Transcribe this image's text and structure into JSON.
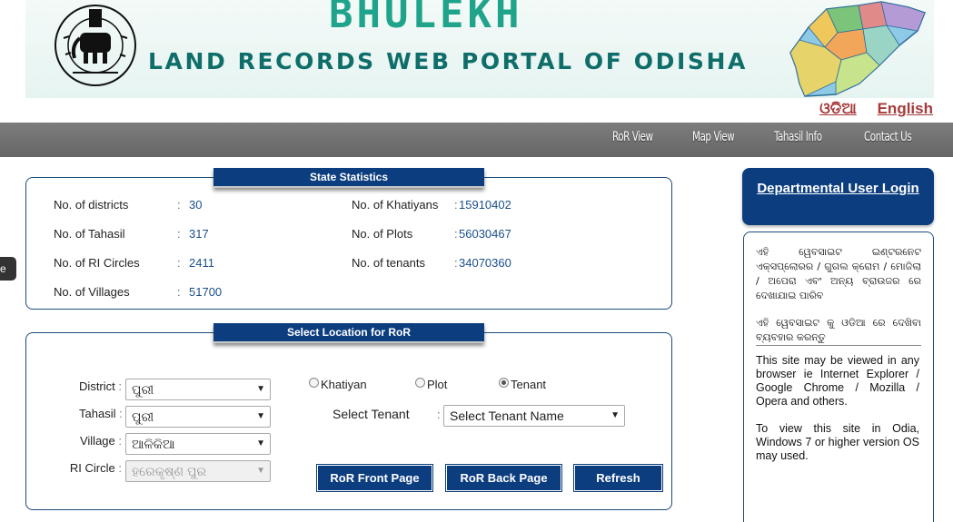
{
  "header": {
    "brand": "BHULEKH",
    "title": "LAND RECORDS WEB PORTAL OF ODISHA",
    "languages": [
      "ଓଡିଆ",
      "English"
    ]
  },
  "nav": {
    "items": [
      "RoR View",
      "Map View",
      "Tahasil Info",
      "Contact Us"
    ]
  },
  "side_tab": {
    "label": "e"
  },
  "state_statistics": {
    "heading": "State Statistics",
    "left": [
      {
        "label": "No. of districts",
        "value": "30"
      },
      {
        "label": "No. of Tahasil",
        "value": "317"
      },
      {
        "label": "No. of RI Circles",
        "value": "2411"
      },
      {
        "label": "No. of Villages",
        "value": "51700"
      }
    ],
    "right": [
      {
        "label": "No. of Khatiyans",
        "value": "15910402"
      },
      {
        "label": "No. of Plots",
        "value": "56030467"
      },
      {
        "label": "No. of tenants",
        "value": "34070360"
      }
    ],
    "separator": ":"
  },
  "ror": {
    "heading": "Select Location for RoR",
    "district": {
      "label": "District",
      "value": "ପୁରୀ"
    },
    "tahasil": {
      "label": "Tahasil",
      "value": "ପୁରୀ"
    },
    "village": {
      "label": "Village",
      "value": "ଆଳିକିଆ"
    },
    "ri_circle": {
      "label": "RI Circle",
      "value": "ହରେକୃଷ୍ଣ ପୁର"
    },
    "search_by": {
      "options": [
        "Khatiyan",
        "Plot",
        "Tenant"
      ],
      "selected": "Tenant"
    },
    "tenant": {
      "label": "Select Tenant",
      "value": "Select Tenant Name"
    },
    "buttons": {
      "front": "RoR Front Page",
      "back": "RoR Back Page",
      "refresh": "Refresh"
    }
  },
  "sidebar": {
    "login_label": "Departmental User Login",
    "odia_note_1": "ଏହି ୱେବସାଇଟ ଇଣ୍ଟରନେଟ ଏକ୍ସପ୍ଲୋରର / ଗୁଗଲ କ୍ରୋମ / ମୋଜିଲା / ଅପେରା ଏବଂ ଅନ୍ୟ ବ୍ରାଉଜର ରେ ଦେଖାଯାଇ ପାରିବ",
    "odia_note_2": "ଏହି ୱେବସାଇଟ କୁ ଓଡିଆ ରେ ଦେଖିବା ବ୍ୟବହାର କରନ୍ତୁ",
    "en_note_1": "This site may be viewed in any browser ie Internet Explorer / Google Chrome / Mozilla / Opera and others.",
    "en_note_2": "To view this site in Odia, Windows 7 or higher version OS may used."
  },
  "colors": {
    "primary": "#0b3d7f",
    "nav_gray": "#707070",
    "brand_teal": "#1fa38a",
    "lang_link": "#a63a3a"
  }
}
